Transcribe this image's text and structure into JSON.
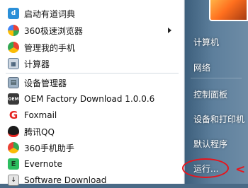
{
  "pinned_items": [
    {
      "label": "启动有道词典",
      "icon": "youdao-dict-icon"
    },
    {
      "label": "360极速浏览器",
      "icon": "browser-360-icon",
      "has_submenu": true
    },
    {
      "label": "管理我的手机",
      "icon": "phone-manager-icon"
    },
    {
      "label": "计算器",
      "icon": "calculator-icon"
    }
  ],
  "recent_items": [
    {
      "label": "设备管理器",
      "icon": "device-manager-icon"
    },
    {
      "label": "OEM Factory Download 1.0.0.6",
      "icon": "oem-factory-icon"
    },
    {
      "label": "Foxmail",
      "icon": "foxmail-icon"
    },
    {
      "label": "腾讯QQ",
      "icon": "qq-icon"
    },
    {
      "label": "360手机助手",
      "icon": "phone-assistant-360-icon"
    },
    {
      "label": "Evernote",
      "icon": "evernote-icon"
    },
    {
      "label": "Software Download",
      "icon": "software-download-icon"
    }
  ],
  "right_items": [
    {
      "label": "计算机"
    },
    {
      "label": "网络"
    },
    {
      "label": "控制面板"
    },
    {
      "label": "设备和打印机"
    },
    {
      "label": "默认程序"
    },
    {
      "label": "运行..."
    }
  ],
  "annotation_arrow": "<",
  "colors": {
    "highlight_red": "#e8141c",
    "right_panel": "#5d7f9c"
  }
}
